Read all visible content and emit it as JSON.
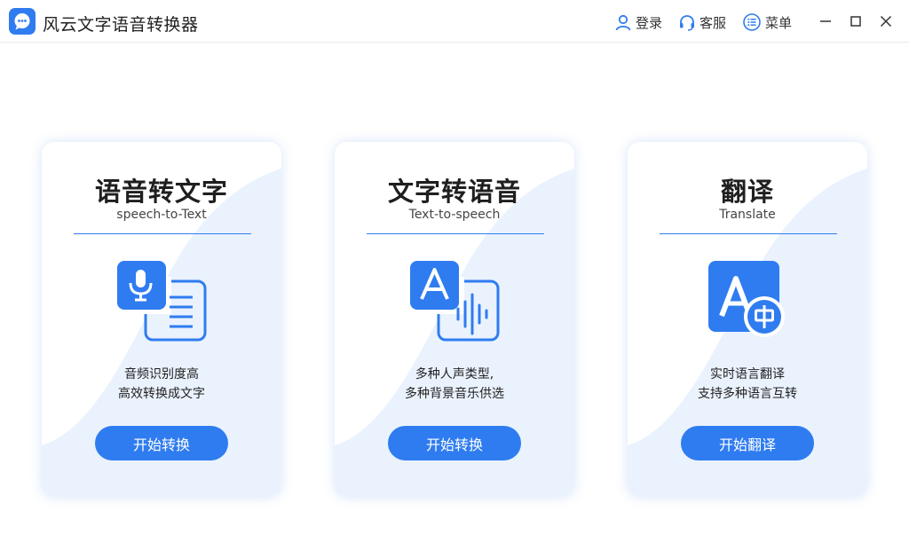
{
  "app": {
    "title": "风云文字语音转换器",
    "accent_color": "#2f7cf0"
  },
  "toolbar": {
    "login_label": "登录",
    "service_label": "客服",
    "menu_label": "菜单",
    "login_icon": "user-icon",
    "service_icon": "headset-icon",
    "menu_icon": "menu-list-icon"
  },
  "cards": [
    {
      "title": "语音转文字",
      "subtitle": "speech-to-Text",
      "icon": "microphone-document-icon",
      "desc_line1": "音频识别度高",
      "desc_line2": "高效转换成文字",
      "button_label": "开始转换"
    },
    {
      "title": "文字转语音",
      "subtitle": "Text-to-speech",
      "icon": "text-audio-wave-icon",
      "desc_line1": "多种人声类型,",
      "desc_line2": "多种背景音乐供选",
      "button_label": "开始转换"
    },
    {
      "title": "翻译",
      "subtitle": "Translate",
      "icon": "translate-icon",
      "desc_line1": "实时语言翻译",
      "desc_line2": "支持多种语言互转",
      "button_label": "开始翻译"
    }
  ]
}
